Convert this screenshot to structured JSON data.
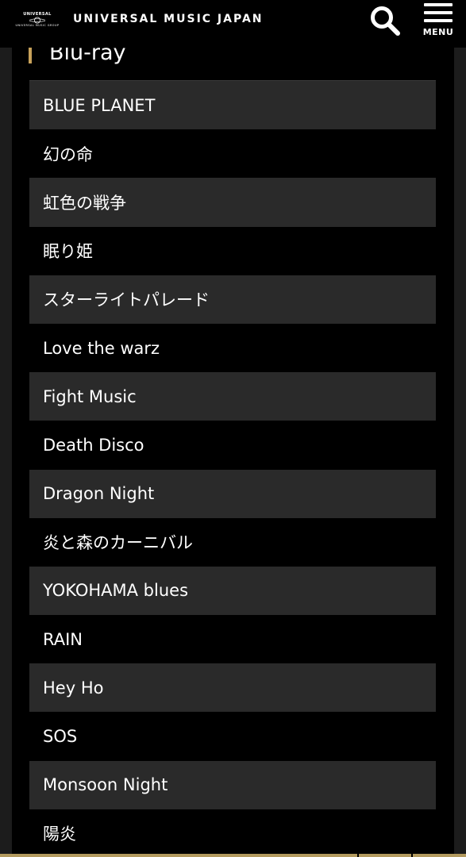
{
  "header": {
    "logo": {
      "top": "UNIVERSAL",
      "bottom": "UNIVERSAL MUSIC GROUP"
    },
    "brand": "UNIVERSAL MUSIC JAPAN",
    "search_icon": "search-icon",
    "menu_icon": "hamburger-menu-icon",
    "menu_label": "MENU"
  },
  "section": {
    "title": "Blu-ray",
    "accent_color": "#c8a25a"
  },
  "tracks": [
    "BLUE PLANET",
    "幻の命",
    "虹色の戦争",
    "眠り姫",
    "スターライトパレード",
    "Love the warz",
    "Fight Music",
    "Death Disco",
    "Dragon Night",
    "炎と森のカーニバル",
    "YOKOHAMA blues",
    "RAIN",
    "Hey Ho",
    "SOS",
    "Monsoon Night",
    "陽炎"
  ],
  "colors": {
    "background": "#000000",
    "row_shaded": "#2a2a2a",
    "gutter": "#1c1c1c",
    "bottom_bar": "#b39a5e"
  }
}
